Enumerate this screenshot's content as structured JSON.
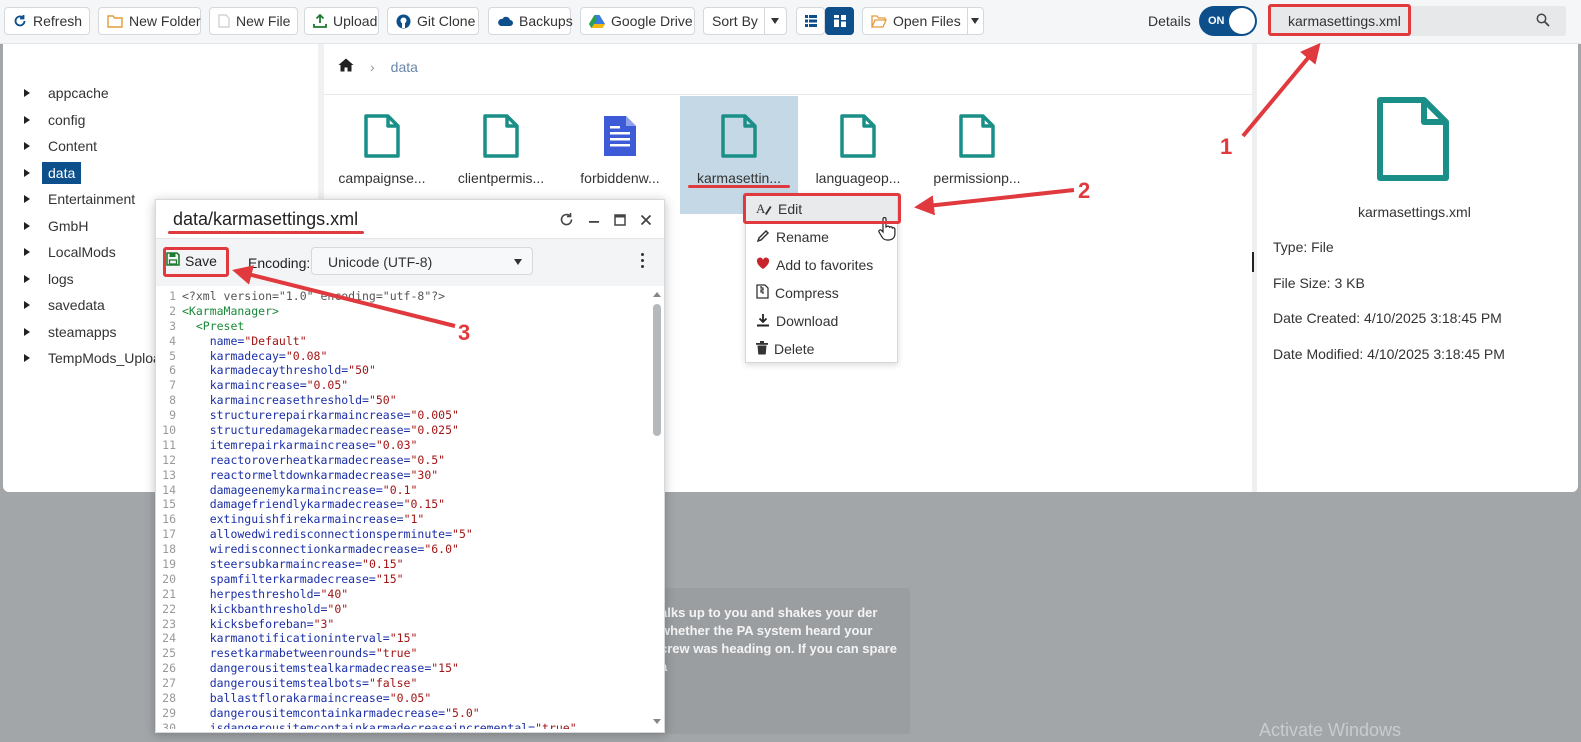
{
  "toolbar": {
    "refresh": "Refresh",
    "new_folder": "New Folder",
    "new_file": "New File",
    "upload": "Upload",
    "git_clone": "Git Clone",
    "backups": "Backups",
    "google_drive": "Google Drive",
    "sort_by": "Sort By",
    "open_files": "Open Files",
    "details_label": "Details",
    "toggle": "ON"
  },
  "search": {
    "value": "karmasettings.xml"
  },
  "tree": [
    {
      "label": "appcache",
      "active": false
    },
    {
      "label": "config",
      "active": false
    },
    {
      "label": "Content",
      "active": false
    },
    {
      "label": "data",
      "active": true
    },
    {
      "label": "Entertainment",
      "active": false
    },
    {
      "label": "GmbH",
      "active": false
    },
    {
      "label": "LocalMods",
      "active": false
    },
    {
      "label": "logs",
      "active": false
    },
    {
      "label": "savedata",
      "active": false
    },
    {
      "label": "steamapps",
      "active": false
    },
    {
      "label": "TempMods_Upload",
      "active": false
    }
  ],
  "breadcrumb": {
    "current": "data"
  },
  "files": [
    {
      "name": "campaignse...",
      "icon": "file-icon"
    },
    {
      "name": "clientpermis...",
      "icon": "file-icon"
    },
    {
      "name": "forbiddenw...",
      "icon": "text-file-icon"
    },
    {
      "name": "karmasettin...",
      "icon": "file-icon",
      "selected": true
    },
    {
      "name": "languageop...",
      "icon": "file-icon"
    },
    {
      "name": "permissionp...",
      "icon": "file-icon"
    }
  ],
  "context_menu": [
    {
      "label": "Edit",
      "icon": "edit-icon"
    },
    {
      "label": "Rename",
      "icon": "pencil-icon"
    },
    {
      "label": "Add to favorites",
      "icon": "heart-icon"
    },
    {
      "label": "Compress",
      "icon": "compress-icon"
    },
    {
      "label": "Download",
      "icon": "download-icon"
    },
    {
      "label": "Delete",
      "icon": "trash-icon"
    }
  ],
  "details": {
    "name": "karmasettings.xml",
    "type": "Type: File",
    "size": "File Size: 3 KB",
    "created": "Date Created: 4/10/2025 3:18:45 PM",
    "modified": "Date Modified: 4/10/2025 3:18:45 PM"
  },
  "editor": {
    "title": "data/karmasettings.xml",
    "save": "Save",
    "encoding_label": "Encoding:",
    "encoding_value": "Unicode (UTF-8)",
    "lines": [
      {
        "n": "1",
        "kind": "decl",
        "text": "<?xml version=\"1.0\" encoding=\"utf-8\"?>"
      },
      {
        "n": "2",
        "kind": "tag",
        "text": "<KarmaManager>"
      },
      {
        "n": "3",
        "kind": "tag",
        "text": "  <Preset"
      },
      {
        "n": "4",
        "kind": "attr",
        "name": "    name=",
        "value": "\"Default\""
      },
      {
        "n": "5",
        "kind": "attr",
        "name": "    karmadecay=",
        "value": "\"0.08\""
      },
      {
        "n": "6",
        "kind": "attr",
        "name": "    karmadecaythreshold=",
        "value": "\"50\""
      },
      {
        "n": "7",
        "kind": "attr",
        "name": "    karmaincrease=",
        "value": "\"0.05\""
      },
      {
        "n": "8",
        "kind": "attr",
        "name": "    karmaincreasethreshold=",
        "value": "\"50\""
      },
      {
        "n": "9",
        "kind": "attr",
        "name": "    structurerepairkarmaincrease=",
        "value": "\"0.005\""
      },
      {
        "n": "10",
        "kind": "attr",
        "name": "    structuredamagekarmadecrease=",
        "value": "\"0.025\""
      },
      {
        "n": "11",
        "kind": "attr",
        "name": "    itemrepairkarmaincrease=",
        "value": "\"0.03\""
      },
      {
        "n": "12",
        "kind": "attr",
        "name": "    reactoroverheatkarmadecrease=",
        "value": "\"0.5\""
      },
      {
        "n": "13",
        "kind": "attr",
        "name": "    reactormeltdownkarmadecrease=",
        "value": "\"30\""
      },
      {
        "n": "14",
        "kind": "attr",
        "name": "    damageenemykarmaincrease=",
        "value": "\"0.1\""
      },
      {
        "n": "15",
        "kind": "attr",
        "name": "    damagefriendlykarmadecrease=",
        "value": "\"0.15\""
      },
      {
        "n": "16",
        "kind": "attr",
        "name": "    extinguishfirekarmaincrease=",
        "value": "\"1\""
      },
      {
        "n": "17",
        "kind": "attr",
        "name": "    allowedwiredisconnectionsperminute=",
        "value": "\"5\""
      },
      {
        "n": "18",
        "kind": "attr",
        "name": "    wiredisconnectionkarmadecrease=",
        "value": "\"6.0\""
      },
      {
        "n": "19",
        "kind": "attr",
        "name": "    steersubkarmaincrease=",
        "value": "\"0.15\""
      },
      {
        "n": "20",
        "kind": "attr",
        "name": "    spamfilterkarmadecrease=",
        "value": "\"15\""
      },
      {
        "n": "21",
        "kind": "attr",
        "name": "    herpesthreshold=",
        "value": "\"40\""
      },
      {
        "n": "22",
        "kind": "attr",
        "name": "    kickbanthreshold=",
        "value": "\"0\""
      },
      {
        "n": "23",
        "kind": "attr",
        "name": "    kicksbeforeban=",
        "value": "\"3\""
      },
      {
        "n": "24",
        "kind": "attr",
        "name": "    karmanotificationinterval=",
        "value": "\"15\""
      },
      {
        "n": "25",
        "kind": "attr",
        "name": "    resetkarmabetweenrounds=",
        "value": "\"true\""
      },
      {
        "n": "26",
        "kind": "attr",
        "name": "    dangerousitemstealkarmadecrease=",
        "value": "\"15\""
      },
      {
        "n": "27",
        "kind": "attr",
        "name": "    dangerousitemstealbots=",
        "value": "\"false\""
      },
      {
        "n": "28",
        "kind": "attr",
        "name": "    ballastflorakarmaincrease=",
        "value": "\"0.05\""
      },
      {
        "n": "29",
        "kind": "attr",
        "name": "    dangerousitemcontainkarmadecrease=",
        "value": "\"5.0\""
      },
      {
        "n": "30",
        "kind": "attr",
        "name": "    isdangerousitemcontainkarmadecreaseincremental=",
        "value": "\"true\""
      }
    ]
  },
  "background": {
    "text": "alks up to you and shakes your der whether the PA system heard your crew was heading on. If you can spare a",
    "watermark": "Activate Windows"
  },
  "annotations": [
    "1",
    "2",
    "3"
  ],
  "colors": {
    "accent": "#0d4f8b",
    "annotation": "#e0393e",
    "file_icon": "#1a8f87",
    "text_icon": "#3d5bd6"
  }
}
